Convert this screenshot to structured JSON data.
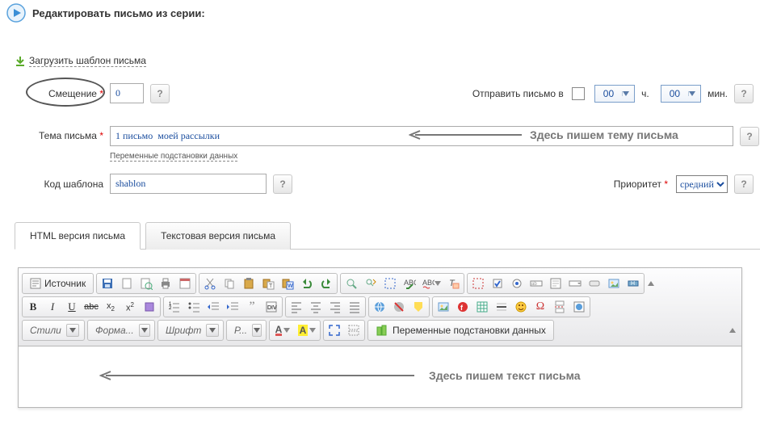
{
  "header": {
    "title": "Редактировать письмо из серии:"
  },
  "load_template_link": "Загрузить шаблон письма",
  "offset": {
    "label": "Смещение",
    "value": "0"
  },
  "send_time": {
    "label": "Отправить письмо в",
    "hour": "00",
    "hour_suffix": "ч.",
    "minute": "00",
    "minute_suffix": "мин."
  },
  "subject": {
    "label": "Тема письма",
    "value": "1 письмо  моей рассылки",
    "vars_link": "Переменные подстановки данных"
  },
  "template_code": {
    "label": "Код шаблона",
    "value": "shablon"
  },
  "priority": {
    "label": "Приоритет",
    "value": "средний"
  },
  "tabs": {
    "html": "HTML версия письма",
    "text": "Текстовая версия письма"
  },
  "annotations": {
    "subject_hint": "Здесь пишем тему письма",
    "body_hint": "Здесь пишем  текст письма"
  },
  "toolbar": {
    "source": "Источник",
    "styles": "Стили",
    "format": "Форма...",
    "font": "Шрифт",
    "size": "Р...",
    "vars_btn": "Переменные подстановки данных"
  },
  "icons": {
    "play": "play-icon",
    "download": "download-arrow-icon",
    "help": "question-icon",
    "save": "save-icon",
    "newpage": "new-page-icon",
    "preview": "preview-icon",
    "print": "print-icon",
    "template": "template-icon",
    "cut": "cut-icon",
    "copy": "copy-icon",
    "paste": "paste-icon",
    "paste_text": "paste-text-icon",
    "paste_word": "paste-word-icon",
    "undo": "undo-icon",
    "redo": "redo-icon",
    "find": "find-icon",
    "replace": "replace-icon",
    "selectall": "select-all-icon",
    "spell": "spellcheck-icon",
    "scayt": "scayt-icon",
    "remove_format": "remove-format-icon",
    "form": "form-icon",
    "checkbox2": "checkbox-icon",
    "radio": "radio-icon",
    "textfield": "textfield-icon",
    "textarea": "textarea-icon",
    "select": "select-icon",
    "button": "button-icon",
    "imagebutton": "image-button-icon",
    "hidden": "hidden-field-icon",
    "bold": "bold-icon",
    "italic": "italic-icon",
    "underline": "underline-icon",
    "strike": "strike-icon",
    "sub": "subscript-icon",
    "sup": "superscript-icon",
    "obj": "object-icon",
    "ol": "ordered-list-icon",
    "ul": "unordered-list-icon",
    "outdent": "outdent-icon",
    "indent": "indent-icon",
    "quote": "blockquote-icon",
    "div": "div-icon",
    "aleft": "align-left-icon",
    "acenter": "align-center-icon",
    "aright": "align-right-icon",
    "ajust": "align-justify-icon",
    "link": "link-icon",
    "unlink": "unlink-icon",
    "anchor": "anchor-icon",
    "image": "image-icon",
    "flash": "flash-icon",
    "table": "table-icon",
    "hr": "hr-icon",
    "smiley": "smiley-icon",
    "char": "special-char-icon",
    "pgbrk": "page-break-icon",
    "iframe": "iframe-icon",
    "txtcol": "text-color-icon",
    "bgcol": "bg-color-icon",
    "max": "maximize-icon",
    "blocks": "show-blocks-icon",
    "about": "about-icon"
  }
}
